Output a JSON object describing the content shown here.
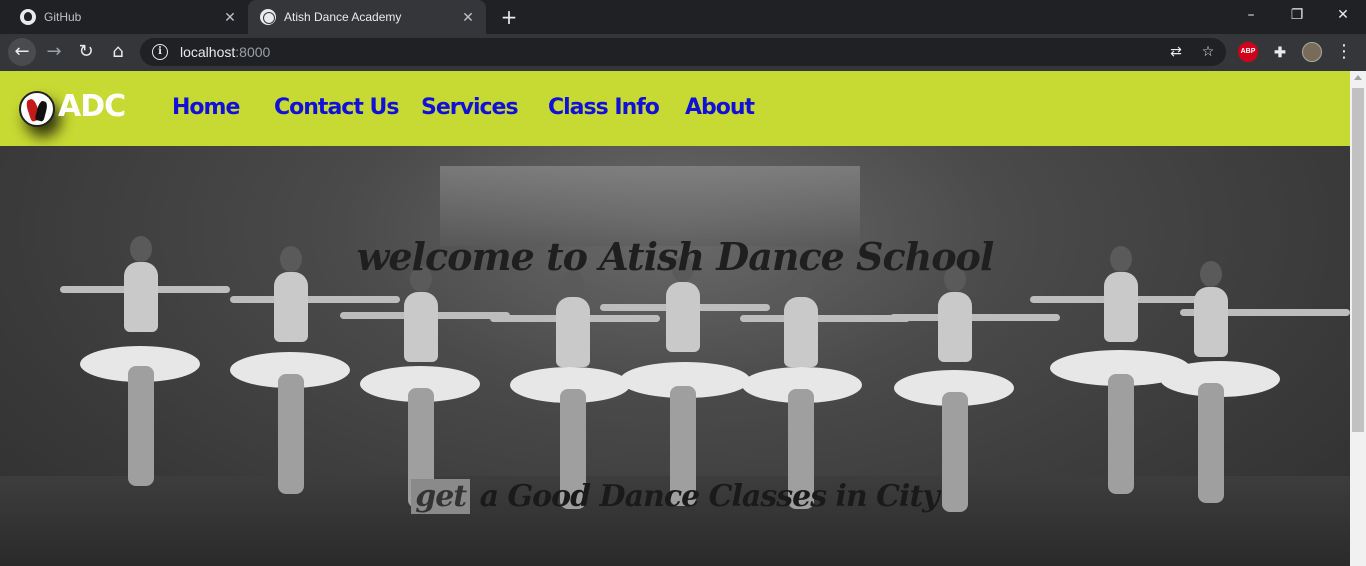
{
  "browser": {
    "tabs": [
      {
        "title": "GitHub",
        "icon": "github-icon",
        "active": false
      },
      {
        "title": "Atish Dance Academy",
        "icon": "globe-icon",
        "active": true
      }
    ],
    "new_tab_symbol": "+",
    "close_symbol": "✕",
    "window_controls": {
      "minimize": "–",
      "restore": "❐",
      "close": "✕"
    },
    "nav": {
      "back": "←",
      "forward": "→",
      "reload": "↻",
      "home": "⌂"
    },
    "address": {
      "host": "localhost",
      "port": ":8000"
    },
    "omnibox_icons": {
      "translate": "⇄",
      "bookmark": "☆"
    },
    "extensions": [
      {
        "name": "adblock-plus-icon",
        "label": "ABP",
        "color": "#d0021b"
      },
      {
        "name": "extensions-icon"
      },
      {
        "name": "profile-avatar"
      }
    ],
    "menu_symbol": "⋮"
  },
  "site": {
    "colors": {
      "navbar_bg": "#c7da33",
      "nav_link": "#1010d8",
      "logo_text": "#ffffff"
    },
    "logo_text": "ADC",
    "nav_links": [
      "Home",
      "Contact Us",
      "Services",
      "Class Info",
      "About"
    ],
    "hero_title": "welcome to Atish Dance School",
    "tagline_highlight": "get",
    "tagline_rest": "a Good Dance Classes in City"
  }
}
